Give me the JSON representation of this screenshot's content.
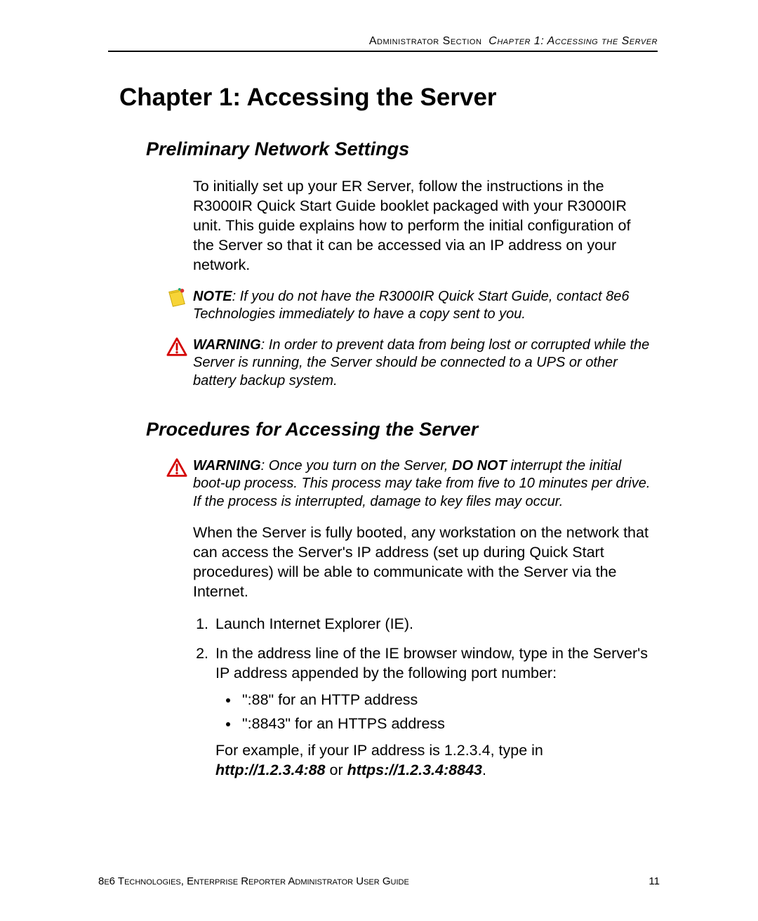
{
  "header": {
    "section": "Administrator Section",
    "chapter": "Chapter 1: Accessing the Server"
  },
  "chapter_title": "Chapter 1: Accessing the Server",
  "section1": {
    "title": "Preliminary Network Settings",
    "intro": "To initially set up your ER Server, follow the instructions in the R3000IR Quick Start Guide booklet packaged with your R3000IR unit. This guide explains how to perform the initial configuration of the Server so that it can be accessed via an IP address on your network.",
    "note_label": "NOTE",
    "note_text": ": If you do not have the R3000IR Quick Start Guide, contact 8e6 Technologies immediately to have a copy sent to you.",
    "warning_label": "WARNING",
    "warning_text": ": In order to prevent data from being lost or corrupted while the Server is running, the Server should be connected to a UPS or other battery backup system."
  },
  "section2": {
    "title": "Procedures for Accessing the Server",
    "warning_label": "WARNING",
    "warning_pre": ": Once you turn on the Server, ",
    "warning_bold": "DO NOT",
    "warning_post": " interrupt the initial boot-up process. This process may take from five to 10 minutes per drive. If the process is interrupted, damage to key files may occur.",
    "para1": "When the Server is fully booted, any workstation on the network that can access the Server's IP address (set up during Quick Start procedures) will be able to communicate with the Server via the Internet.",
    "step1": "Launch Internet Explorer (IE).",
    "step2_intro": "In the address line of the IE browser window, type in the Server's IP address appended by the following port number:",
    "bullet1": "\":88\" for an HTTP address",
    "bullet2": "\":8843\" for an HTTPS address",
    "step2_tail_pre": "For example, if your IP address is 1.2.3.4, type in ",
    "step2_tail_b1": "http://1.2.3.4:88",
    "step2_tail_mid": " or ",
    "step2_tail_b2": "https://1.2.3.4:8843",
    "step2_tail_end": "."
  },
  "footer": {
    "left": "8e6 Technologies, Enterprise Reporter Administrator User Guide",
    "right": "11"
  }
}
